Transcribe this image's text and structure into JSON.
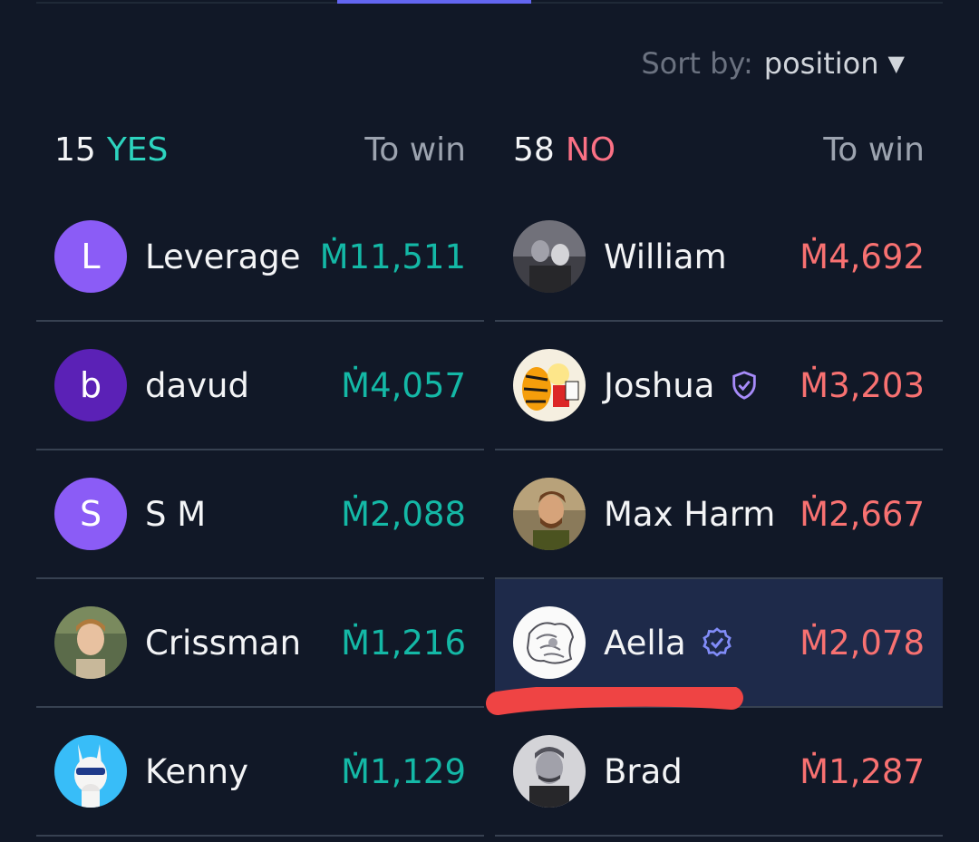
{
  "sort": {
    "label": "Sort by:",
    "value": "position",
    "caret": "▼"
  },
  "yes": {
    "count": "15",
    "label": "YES",
    "to_win_label": "To win",
    "rows": [
      {
        "initial": "L",
        "name": "Leverage",
        "amount": "Ṁ11,511",
        "avatar_color": "#8b5cf6"
      },
      {
        "initial": "b",
        "name": "davud",
        "amount": "Ṁ4,057",
        "avatar_color": "#5b21b6"
      },
      {
        "initial": "S",
        "name": "S M",
        "amount": "Ṁ2,088",
        "avatar_color": "#8b5cf6"
      },
      {
        "name": "Crissman",
        "amount": "Ṁ1,216",
        "avatar_icon": "photo-avatar"
      },
      {
        "name": "Kenny",
        "amount": "Ṁ1,129",
        "avatar_icon": "llama-avatar"
      }
    ]
  },
  "no": {
    "count": "58",
    "label": "NO",
    "to_win_label": "To win",
    "rows": [
      {
        "name": "William",
        "amount": "Ṁ4,692",
        "avatar_icon": "photo-avatar"
      },
      {
        "name": "Joshua",
        "amount": "Ṁ3,203",
        "avatar_icon": "comic-avatar",
        "badge": "shield-check-icon"
      },
      {
        "name": "Max Harm",
        "amount": "Ṁ2,667",
        "avatar_icon": "photo-avatar"
      },
      {
        "name": "Aella",
        "amount": "Ṁ2,078",
        "avatar_icon": "sketch-avatar",
        "badge": "verified-icon",
        "highlighted": true
      },
      {
        "name": "Brad",
        "amount": "Ṁ1,287",
        "avatar_icon": "photo-avatar"
      }
    ]
  },
  "colors": {
    "background": "#111827",
    "yes": "#14b8a6",
    "no": "#f87171",
    "accent": "#6366f1",
    "highlight_row": "#1e2a4a",
    "markup_stroke": "#ef4444"
  }
}
